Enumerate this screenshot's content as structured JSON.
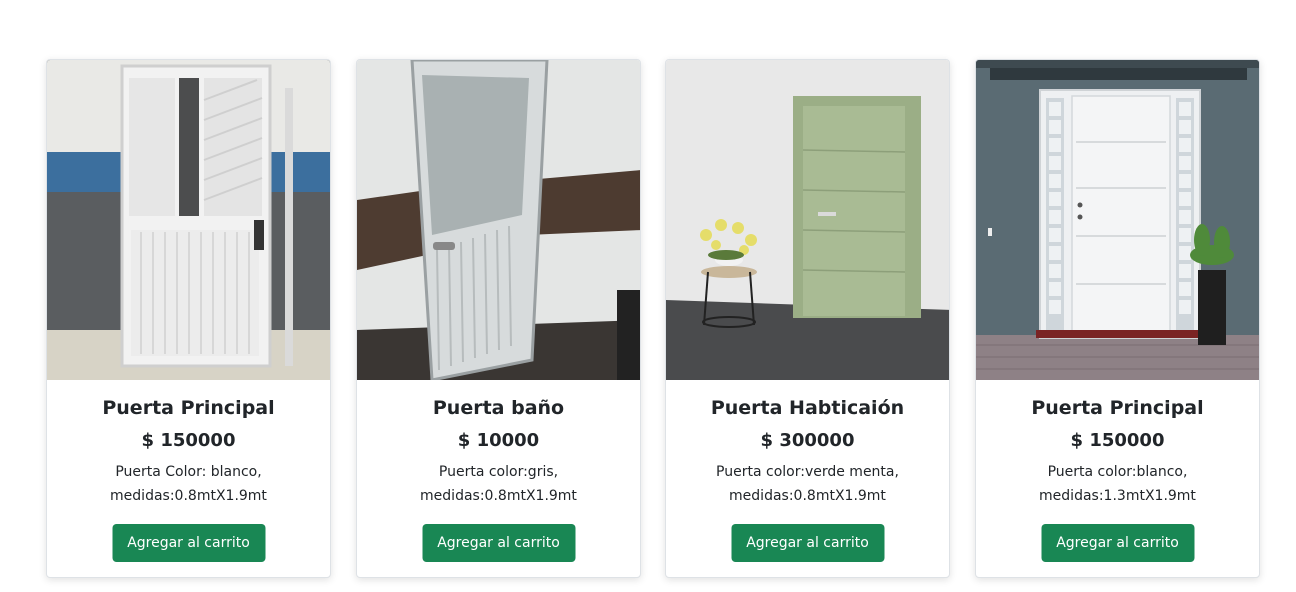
{
  "products": [
    {
      "name": "Puerta Principal",
      "price": "$ 150000",
      "description": "Puerta Color: blanco, medidas:0.8mtX1.9mt",
      "button_label": "Agregar al carrito"
    },
    {
      "name": "Puerta baño",
      "price": "$ 10000",
      "description": "Puerta color:gris, medidas:0.8mtX1.9mt",
      "button_label": "Agregar al carrito"
    },
    {
      "name": "Puerta Habticaión",
      "price": "$ 300000",
      "description": "Puerta color:verde menta, medidas:0.8mtX1.9mt",
      "button_label": "Agregar al carrito"
    },
    {
      "name": "Puerta Principal",
      "price": "$ 150000",
      "description": "Puerta color:blanco, medidas:1.3mtX1.9mt",
      "button_label": "Agregar al carrito"
    }
  ],
  "colors": {
    "button": "#198754",
    "card_border": "#dee2e6"
  }
}
